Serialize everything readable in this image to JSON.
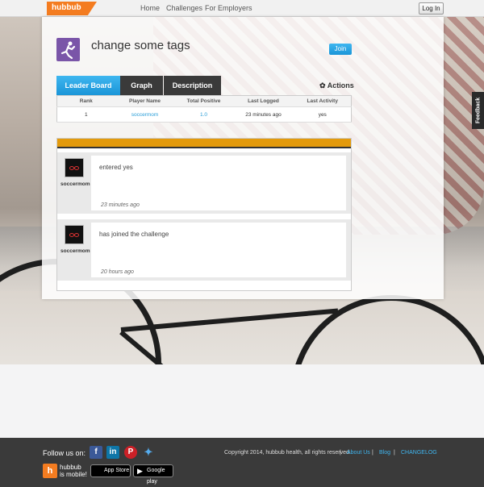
{
  "nav": {
    "logo": "hubbub",
    "links": [
      "Home",
      "Challenges",
      "For Employers"
    ],
    "login": "Log In"
  },
  "challenge": {
    "title": "change some tags",
    "join": "Join"
  },
  "tabs": [
    "Leader Board",
    "Graph",
    "Description"
  ],
  "actions": "Actions",
  "leaderboard": {
    "columns": [
      "Rank",
      "Player Name",
      "Total Positive",
      "Last Logged",
      "Last Activity"
    ],
    "rows": [
      {
        "rank": "1",
        "player": "soccermom",
        "total": "1.0",
        "logged": "23 minutes ago",
        "activity": "yes"
      }
    ]
  },
  "feed": [
    {
      "user": "soccermom",
      "message": "entered yes",
      "time": "23 minutes ago"
    },
    {
      "user": "soccermom",
      "message": "has joined the challenge",
      "time": "20 hours ago"
    }
  ],
  "feedback": "Feedback",
  "footer": {
    "follow": "Follow us on:",
    "social": [
      "facebook",
      "linkedin",
      "pinterest",
      "twitter"
    ],
    "copyright": "Copyright 2014, hubbub health, all rights reserved.",
    "links": [
      "About Us",
      "Blog",
      "CHANGELOG"
    ],
    "separator": "|",
    "mobile_line1": "hubbub",
    "mobile_line2": "is mobile!",
    "appstore": "App Store",
    "googleplay": "Google play"
  },
  "colors": {
    "brand_orange": "#f47c20",
    "accent_blue": "#1a95d8",
    "feed_bar": "#e39a0c"
  }
}
